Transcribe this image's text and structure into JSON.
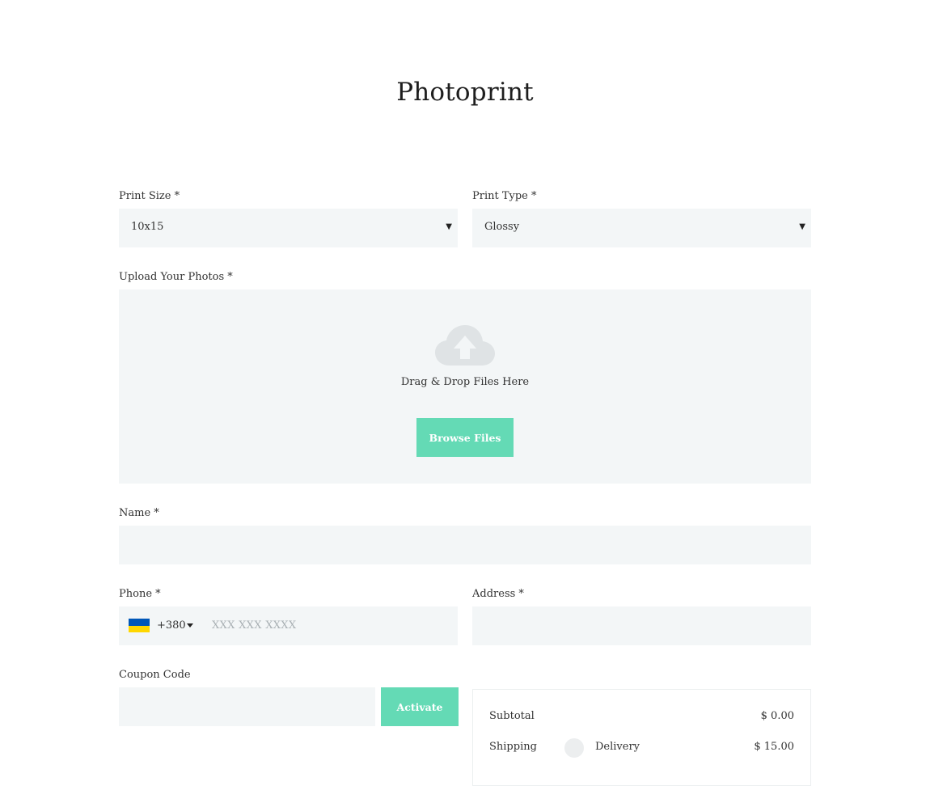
{
  "page": {
    "title": "Photoprint"
  },
  "print_size": {
    "label": "Print Size *",
    "value": "10x15"
  },
  "print_type": {
    "label": "Print Type *",
    "value": "Glossy"
  },
  "upload": {
    "label": "Upload Your Photos *",
    "drop_text": "Drag & Drop Files Here",
    "browse_label": "Browse Files",
    "icon": "cloud-upload-icon"
  },
  "name": {
    "label": "Name *",
    "value": ""
  },
  "phone": {
    "label": "Phone *",
    "country_flag": "ukraine-flag-icon",
    "dial_code": "+380",
    "placeholder": "XXX XXX XXXX",
    "value": ""
  },
  "address": {
    "label": "Address *",
    "value": ""
  },
  "coupon": {
    "label": "Coupon Code",
    "value": "",
    "activate_label": "Activate"
  },
  "summary": {
    "subtotal_label": "Subtotal",
    "subtotal_value": "$ 0.00",
    "shipping_label": "Shipping",
    "shipping_option": "Delivery",
    "shipping_value": "$ 15.00"
  },
  "colors": {
    "accent": "#64dab5",
    "field_bg": "#f3f6f7",
    "text": "#333333",
    "flag_blue": "#0057b8",
    "flag_yellow": "#ffd700"
  }
}
